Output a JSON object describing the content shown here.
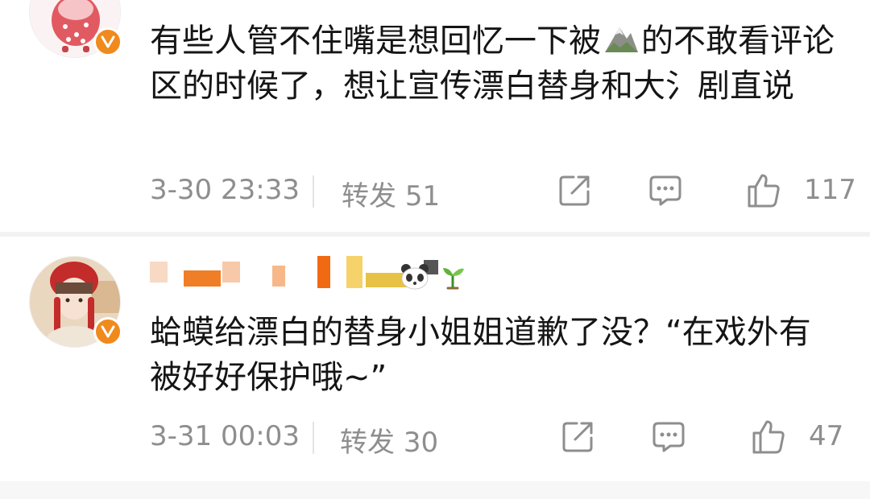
{
  "comments": [
    {
      "text_before_icon": "有些人管不住嘴是想回忆一下被",
      "text_after_icon": "的不敢看评论区的时候了，想让宣传漂白替身和大氵剧直说",
      "time": "3-30 23:33",
      "repost_label": "转发",
      "repost_count": "51",
      "like_count": "117"
    },
    {
      "text": "蛤蟆给漂白的替身小姐姐道歉了没？“在戏外有被好好保护哦~”",
      "time": "3-31 00:03",
      "repost_label": "转发",
      "repost_count": "30",
      "like_count": "47"
    }
  ],
  "icons": {
    "inline_mountain": "mountain-icon",
    "share": "share-icon",
    "comment": "comment-bubble-icon",
    "like": "thumbs-up-icon",
    "verified": "verified-v-badge-icon",
    "username_decoration": "sprout-icon"
  },
  "colors": {
    "accent": "#f08a1c",
    "meta_text": "#8e8e8e",
    "divider": "#f2f2f2"
  }
}
